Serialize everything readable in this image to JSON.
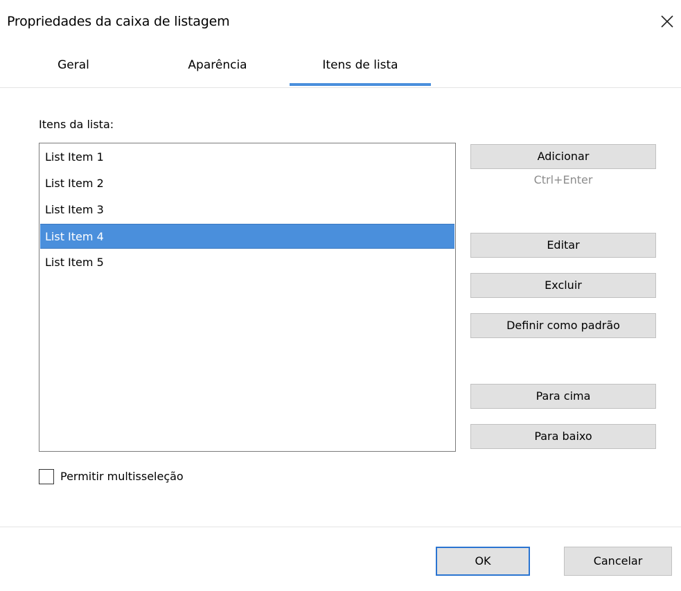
{
  "window": {
    "title": "Propriedades da caixa de listagem",
    "close_icon": "close-x"
  },
  "tabs": [
    {
      "label": "Geral",
      "active": false
    },
    {
      "label": "Aparência",
      "active": false
    },
    {
      "label": "Itens de lista",
      "active": true
    }
  ],
  "list": {
    "label": "Itens da lista:",
    "items": [
      {
        "label": "List Item 1",
        "selected": false
      },
      {
        "label": "List Item 2",
        "selected": false
      },
      {
        "label": "List Item 3",
        "selected": false
      },
      {
        "label": "List Item 4",
        "selected": true
      },
      {
        "label": "List Item 5",
        "selected": false
      }
    ]
  },
  "actions": {
    "add_label": "Adicionar",
    "add_shortcut": "Ctrl+Enter",
    "edit_label": "Editar",
    "delete_label": "Excluir",
    "set_default_label": "Definir como padrão",
    "move_up_label": "Para cima",
    "move_down_label": "Para baixo"
  },
  "options": {
    "multiselect_label": "Permitir multisseleção",
    "multiselect_checked": false
  },
  "footer": {
    "ok_label": "OK",
    "cancel_label": "Cancelar"
  },
  "colors": {
    "accent": "#4a8fdc",
    "button_bg": "#e1e1e1",
    "default_button_border": "#2a74d1",
    "hint_text": "#8c8c8c"
  }
}
